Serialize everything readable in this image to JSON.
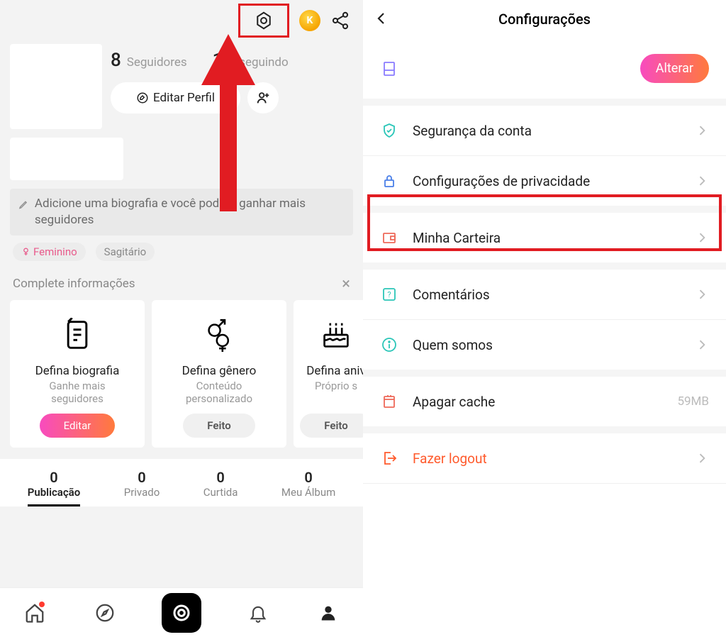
{
  "left": {
    "stats": {
      "followers_num": "8",
      "followers_label": "Seguidores",
      "following_num": "10",
      "following_label": "seguindo"
    },
    "edit_profile_label": "Editar Perfil",
    "bio_prompt": "Adicione uma biografia e você poderá ganhar mais seguidores",
    "tags": {
      "gender": "Feminino",
      "sign": "Sagitário"
    },
    "complete_info_label": "Complete informações",
    "cards": {
      "bio": {
        "title": "Defina biografia",
        "sub1": "Ganhe mais",
        "sub2": "seguidores",
        "btn": "Editar"
      },
      "gender": {
        "title": "Defina gênero",
        "sub1": "Conteúdo",
        "sub2": "personalizado",
        "btn": "Feito"
      },
      "birthday": {
        "title": "Defina aniv",
        "sub1": "Próprio s",
        "btn": "Feito"
      }
    },
    "tabs": {
      "posts": {
        "num": "0",
        "label": "Publicação"
      },
      "private": {
        "num": "0",
        "label": "Privado"
      },
      "liked": {
        "num": "0",
        "label": "Curtida"
      },
      "album": {
        "num": "0",
        "label": "Meu Álbum"
      }
    }
  },
  "right": {
    "header": "Configurações",
    "alterar_label": "Alterar",
    "items": {
      "security": "Segurança da conta",
      "privacy": "Configurações de privacidade",
      "wallet": "Minha Carteira",
      "comments": "Comentários",
      "about": "Quem somos",
      "cache": "Apagar cache",
      "cache_size": "59MB",
      "logout": "Fazer logout"
    }
  }
}
